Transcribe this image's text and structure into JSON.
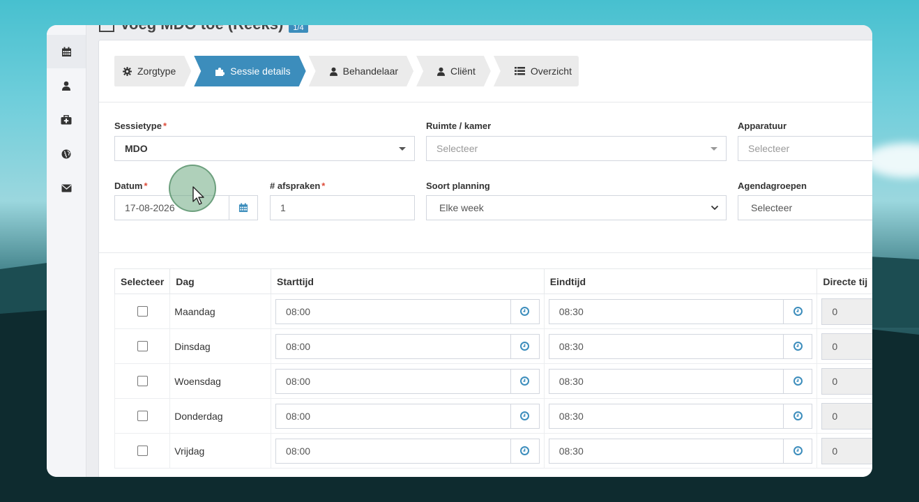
{
  "page": {
    "title": "Voeg MDO toe (Reeks)",
    "badge": "1/4"
  },
  "sidebar": {
    "items": [
      {
        "icon": "calendar-icon"
      },
      {
        "icon": "user-icon"
      },
      {
        "icon": "medkit-icon"
      },
      {
        "icon": "globe-icon"
      },
      {
        "icon": "envelope-icon"
      }
    ]
  },
  "wizard": {
    "steps": [
      {
        "label": "Zorgtype",
        "icon": "gear-icon"
      },
      {
        "label": "Sessie details",
        "icon": "puzzle-icon",
        "active": true
      },
      {
        "label": "Behandelaar",
        "icon": "user-icon"
      },
      {
        "label": "Cliënt",
        "icon": "user-icon"
      },
      {
        "label": "Overzicht",
        "icon": "list-icon"
      }
    ]
  },
  "form": {
    "sessietype": {
      "label": "Sessietype",
      "value": "MDO"
    },
    "ruimte": {
      "label": "Ruimte / kamer",
      "placeholder": "Selecteer"
    },
    "apparatuur": {
      "label": "Apparatuur",
      "placeholder": "Selecteer"
    },
    "datum": {
      "label": "Datum",
      "value": "17-08-2026"
    },
    "afspraken": {
      "label": "# afspraken",
      "value": "1"
    },
    "planning": {
      "label": "Soort planning",
      "value": "Elke week"
    },
    "agendagroepen": {
      "label": "Agendagroepen",
      "placeholder": "Selecteer"
    },
    "required_mark": "*"
  },
  "table": {
    "headers": {
      "select": "Selecteer",
      "day": "Dag",
      "start": "Starttijd",
      "end": "Eindtijd",
      "direct": "Directe tij"
    },
    "rows": [
      {
        "day": "Maandag",
        "start": "08:00",
        "end": "08:30",
        "direct": "0",
        "checked": false
      },
      {
        "day": "Dinsdag",
        "start": "08:00",
        "end": "08:30",
        "direct": "0",
        "checked": false
      },
      {
        "day": "Woensdag",
        "start": "08:00",
        "end": "08:30",
        "direct": "0",
        "checked": false
      },
      {
        "day": "Donderdag",
        "start": "08:00",
        "end": "08:30",
        "direct": "0",
        "checked": false
      },
      {
        "day": "Vrijdag",
        "start": "08:00",
        "end": "08:30",
        "direct": "0",
        "checked": false
      }
    ]
  },
  "colors": {
    "accent": "#3c8dbc",
    "required": "#dd4b39"
  }
}
